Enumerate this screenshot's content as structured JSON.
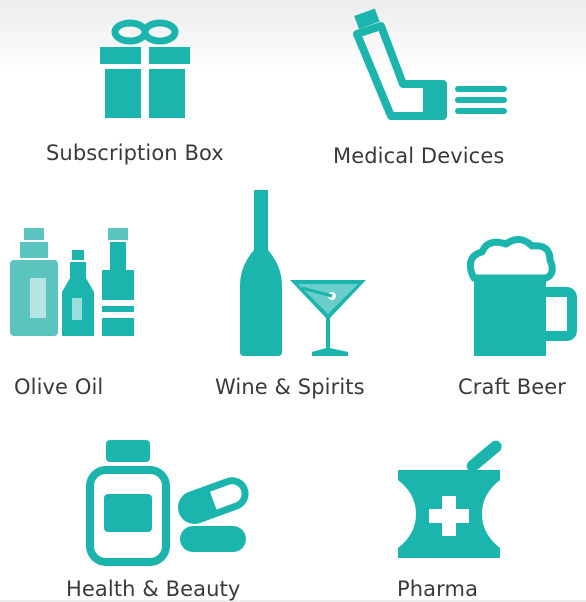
{
  "accent_color": "#1bb5ae",
  "accent_light": "#5cc4bf",
  "label_color": "#3a3a3a",
  "items": [
    {
      "label": "Subscription Box",
      "icon": "gift-box-icon"
    },
    {
      "label": "Medical Devices",
      "icon": "inhaler-icon"
    },
    {
      "label": "Olive Oil",
      "icon": "oil-bottles-icon"
    },
    {
      "label": "Wine & Spirits",
      "icon": "wine-bottle-cocktail-icon"
    },
    {
      "label": "Craft Beer",
      "icon": "beer-mug-icon"
    },
    {
      "label": "Health & Beauty",
      "icon": "pill-bottle-capsules-icon"
    },
    {
      "label": "Pharma",
      "icon": "mortar-pestle-icon"
    }
  ]
}
